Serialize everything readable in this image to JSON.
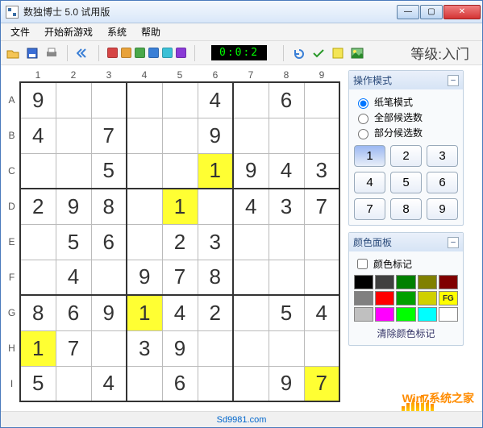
{
  "window": {
    "title": "数独博士 5.0 试用版"
  },
  "menu": {
    "file": "文件",
    "newgame": "开始新游戏",
    "system": "系统",
    "help": "帮助"
  },
  "toolbar": {
    "timer": "0:0:2",
    "quick_colors": [
      "#d64545",
      "#e8a23a",
      "#4aa84a",
      "#3a7fd6",
      "#3ac0d6",
      "#8a3ad6"
    ]
  },
  "level": {
    "label": "等级:",
    "value": "入门"
  },
  "board": {
    "cols": [
      "1",
      "2",
      "3",
      "4",
      "5",
      "6",
      "7",
      "8",
      "9"
    ],
    "rows": [
      "A",
      "B",
      "C",
      "D",
      "E",
      "F",
      "G",
      "H",
      "I"
    ],
    "cells": [
      [
        "9",
        "",
        "",
        "",
        "",
        "4",
        "",
        "6",
        ""
      ],
      [
        "4",
        "",
        "7",
        "",
        "",
        "9",
        "",
        "",
        ""
      ],
      [
        "",
        "",
        "5",
        "",
        "",
        "1",
        "9",
        "4",
        "3"
      ],
      [
        "2",
        "9",
        "8",
        "",
        "1",
        "",
        "4",
        "3",
        "7"
      ],
      [
        "",
        "5",
        "6",
        "",
        "2",
        "3",
        "",
        "",
        ""
      ],
      [
        "",
        "4",
        "",
        "9",
        "7",
        "8",
        "",
        "",
        ""
      ],
      [
        "8",
        "6",
        "9",
        "1",
        "4",
        "2",
        "",
        "5",
        "4"
      ],
      [
        "1",
        "7",
        "",
        "3",
        "9",
        "",
        "",
        "",
        ""
      ],
      [
        "5",
        "",
        "4",
        "",
        "6",
        "",
        "",
        "9",
        "7"
      ]
    ],
    "highlights": [
      [
        2,
        5
      ],
      [
        3,
        4
      ],
      [
        6,
        3
      ],
      [
        7,
        0
      ],
      [
        8,
        8
      ]
    ]
  },
  "side": {
    "mode": {
      "title": "操作模式",
      "opt_pen": "纸笔模式",
      "opt_all": "全部候选数",
      "opt_part": "部分候选数"
    },
    "numpad": [
      "1",
      "2",
      "3",
      "4",
      "5",
      "6",
      "7",
      "8",
      "9"
    ],
    "colors": {
      "title": "颜色面板",
      "mark_label": "颜色标记",
      "palette": [
        "#000000",
        "#404040",
        "#008000",
        "#808000",
        "#800000",
        "#808080",
        "#ff0000",
        "#00a000",
        "#d0d000",
        "FG",
        "#c0c0c0",
        "#ff00ff",
        "#00ff00",
        "#00ffff",
        "#ffffff"
      ],
      "clear": "清除颜色标记"
    }
  },
  "status": {
    "url": "Sd9981.com"
  },
  "watermark": "Win7系统之家"
}
